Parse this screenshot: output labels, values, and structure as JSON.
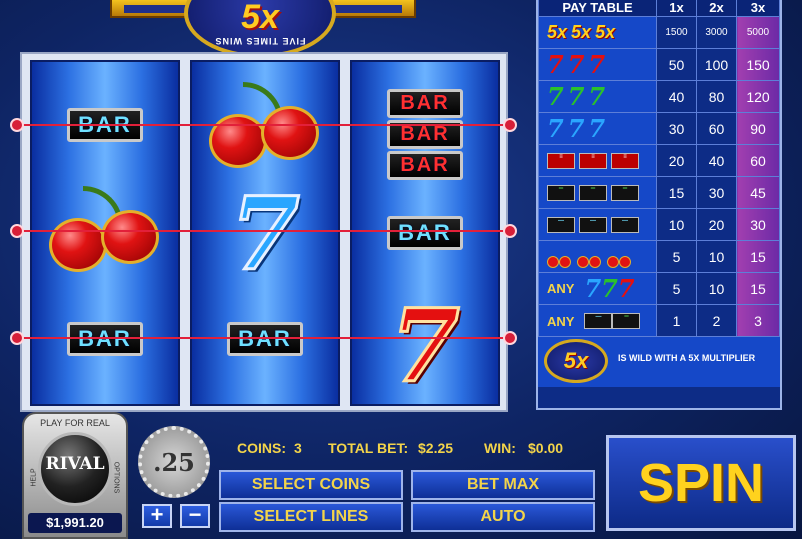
{
  "logo": {
    "big": "5x",
    "ring": "FIVE TIMES WINS"
  },
  "paytable": {
    "header": [
      "PAY TABLE",
      "1x",
      "2x",
      "3x"
    ],
    "rows": [
      {
        "symbol": "5x-5x-5x",
        "prefix": "",
        "pays": [
          "1500",
          "3000",
          "5000"
        ]
      },
      {
        "symbol": "red-seven",
        "prefix": "",
        "pays": [
          "50",
          "100",
          "150"
        ]
      },
      {
        "symbol": "green-seven",
        "prefix": "",
        "pays": [
          "40",
          "80",
          "120"
        ]
      },
      {
        "symbol": "blue-seven",
        "prefix": "",
        "pays": [
          "30",
          "60",
          "90"
        ]
      },
      {
        "symbol": "triple-bar",
        "prefix": "",
        "pays": [
          "20",
          "40",
          "60"
        ]
      },
      {
        "symbol": "double-bar",
        "prefix": "",
        "pays": [
          "15",
          "30",
          "45"
        ]
      },
      {
        "symbol": "single-bar",
        "prefix": "",
        "pays": [
          "10",
          "20",
          "30"
        ]
      },
      {
        "symbol": "cherry",
        "prefix": "",
        "pays": [
          "5",
          "10",
          "15"
        ]
      },
      {
        "symbol": "any-seven",
        "prefix": "ANY",
        "pays": [
          "5",
          "10",
          "15"
        ]
      },
      {
        "symbol": "any-bar",
        "prefix": "ANY",
        "pays": [
          "1",
          "2",
          "3"
        ]
      }
    ],
    "wild_text": "IS WILD WITH A 5X MULTIPLIER",
    "wild_symbol": "5x"
  },
  "reels": {
    "bar_label": "BAR"
  },
  "controls": {
    "play_for_real": "PLAY FOR REAL",
    "brand": "RIVAL",
    "help": "HELP",
    "options": "OPTIONS",
    "balance": "$1,991.20",
    "chip_value": ".25",
    "plus": "+",
    "minus": "−",
    "coins_label": "COINS:",
    "coins_value": "3",
    "total_bet_label": "TOTAL BET:",
    "total_bet_value": "$2.25",
    "win_label": "WIN:",
    "win_value": "$0.00",
    "select_coins": "SELECT COINS",
    "select_lines": "SELECT LINES",
    "bet_max": "BET MAX",
    "auto": "AUTO",
    "spin": "SPIN"
  },
  "colors": {
    "accent": "#f3d44a",
    "payline": "#e2203a",
    "reel_blue": "#2c70e2"
  }
}
